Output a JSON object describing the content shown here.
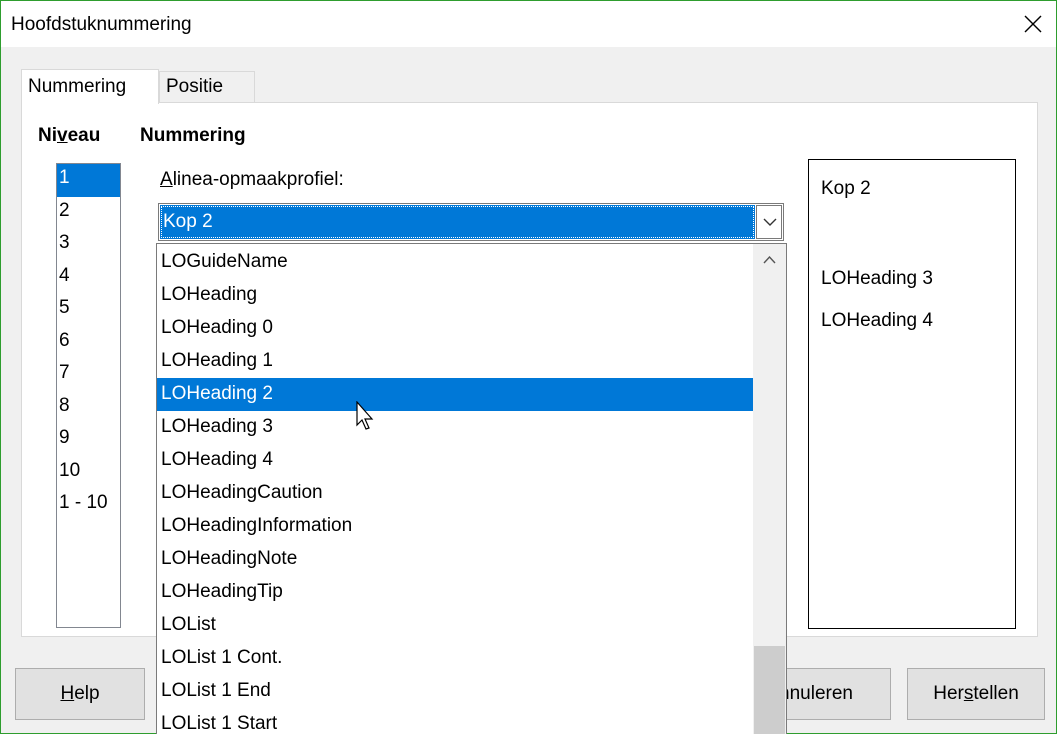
{
  "window": {
    "title": "Hoofdstuknummering"
  },
  "tabs": [
    {
      "label": "Nummering",
      "active": true
    },
    {
      "label": "Positie",
      "active": false
    }
  ],
  "niveau": {
    "heading_pre": "Ni",
    "heading_u": "v",
    "heading_post": "eau",
    "items": [
      "1",
      "2",
      "3",
      "4",
      "5",
      "6",
      "7",
      "8",
      "9",
      "10",
      "1 - 10"
    ],
    "selected_index": 0
  },
  "nummering": {
    "heading": "Nummering",
    "style_label_u": "A",
    "style_label_rest": "linea-opmaakprofiel:",
    "style_value": "Kop 2"
  },
  "dropdown": {
    "items": [
      "LOGuideName",
      "LOHeading",
      "LOHeading 0",
      "LOHeading 1",
      "LOHeading 2",
      "LOHeading 3",
      "LOHeading 4",
      "LOHeadingCaution",
      "LOHeadingInformation",
      "LOHeadingNote",
      "LOHeadingTip",
      "LOList",
      "LOList 1 Cont.",
      "LOList 1 End",
      "LOList 1 Start"
    ],
    "selected_index": 4
  },
  "preview": {
    "lines": [
      "Kop 2",
      "LOHeading 3",
      "LOHeading 4"
    ]
  },
  "buttons": {
    "help_u": "H",
    "help_rest": "elp",
    "annuleren_visible": "nnuleren",
    "herstellen_pre": "Her",
    "herstellen_u": "s",
    "herstellen_post": "tellen"
  },
  "colors": {
    "accent": "#0078d7",
    "window_border": "#2e9d2e"
  },
  "icons": {
    "close": "close-icon",
    "chevron": "chevron-down-icon",
    "scroll_up": "chevron-up-icon",
    "cursor": "mouse-pointer-icon"
  }
}
